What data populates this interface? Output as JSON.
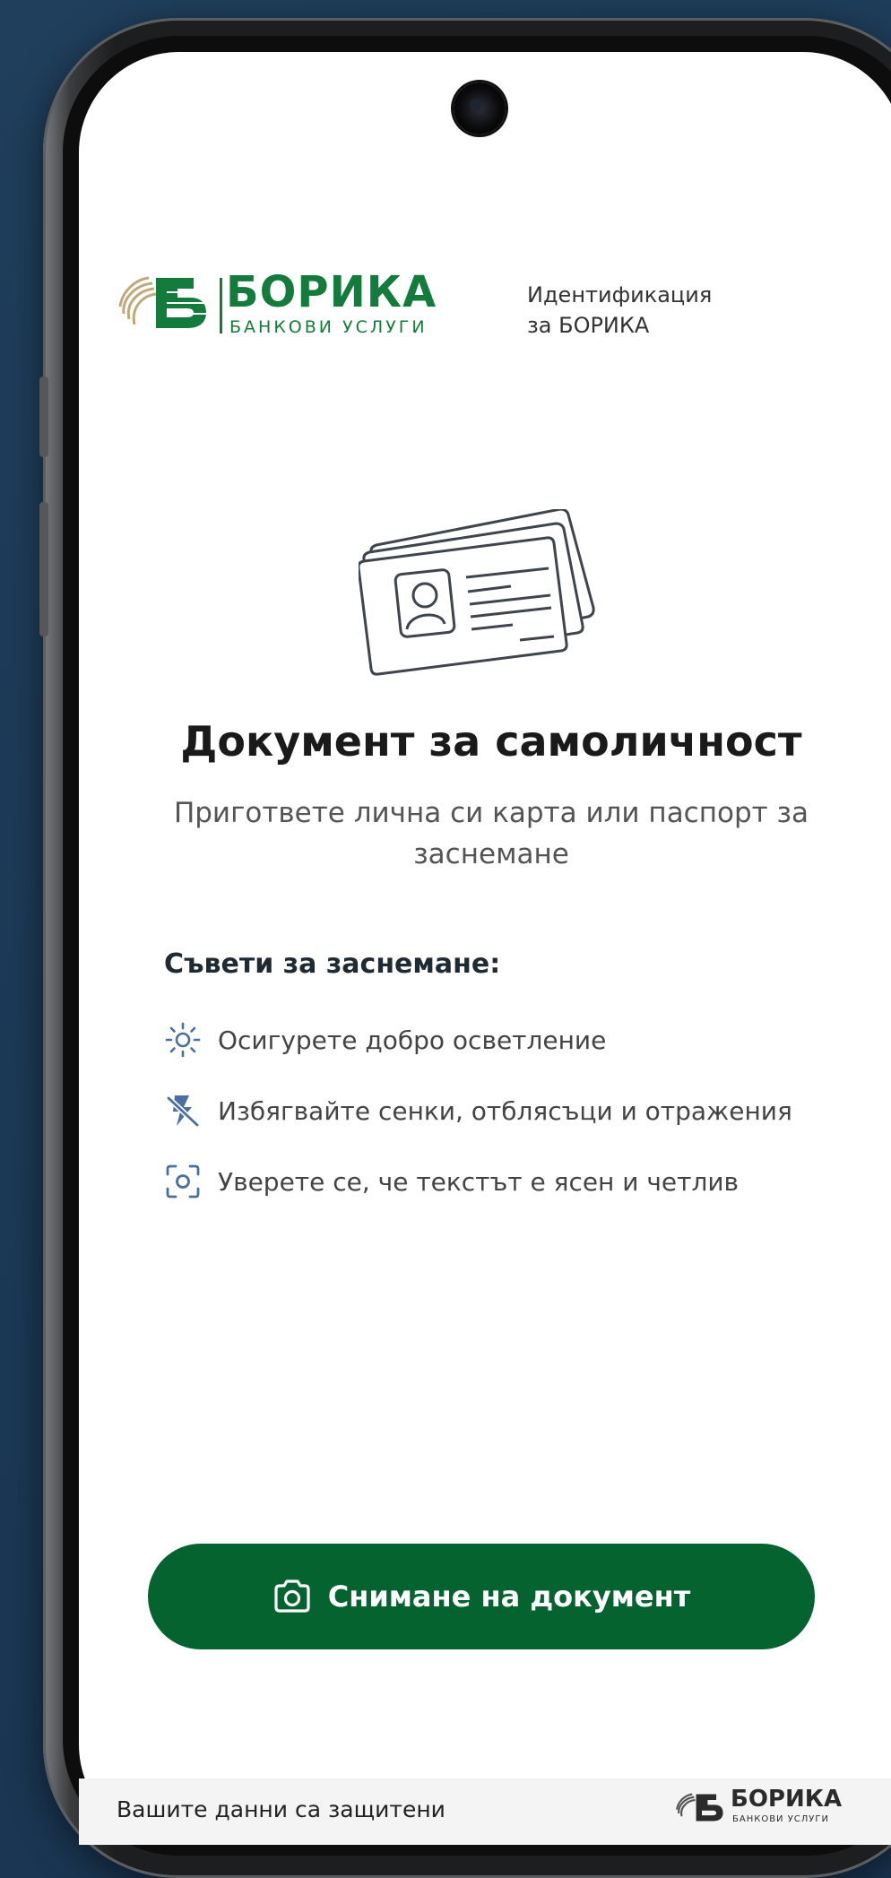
{
  "header": {
    "logo_title": "БОРИКА",
    "logo_subtitle": "БАНКОВИ УСЛУГИ",
    "caption_line1": "Идентификация",
    "caption_line2": "за БОРИКА"
  },
  "main": {
    "title": "Документ за самоличност",
    "subtitle": "Пригответе лична си карта или паспорт за заснемане",
    "tips_heading": "Съвети за заснемане:",
    "tips": [
      {
        "icon": "sun-icon",
        "text": "Осигурете добро осветление"
      },
      {
        "icon": "no-flash-icon",
        "text": "Избягвайте сенки, отблясъци и отражения"
      },
      {
        "icon": "focus-camera-icon",
        "text": "Уверете се, че текстът е ясен и четлив"
      }
    ],
    "capture_button_label": "Снимане на документ"
  },
  "footer": {
    "text": "Вашите данни са защитени",
    "logo_title": "БОРИКА",
    "logo_subtitle": "БАНКОВИ УСЛУГИ"
  },
  "colors": {
    "brand_green": "#137b3c",
    "button_green": "#04632f",
    "background": "#1c3a55"
  }
}
